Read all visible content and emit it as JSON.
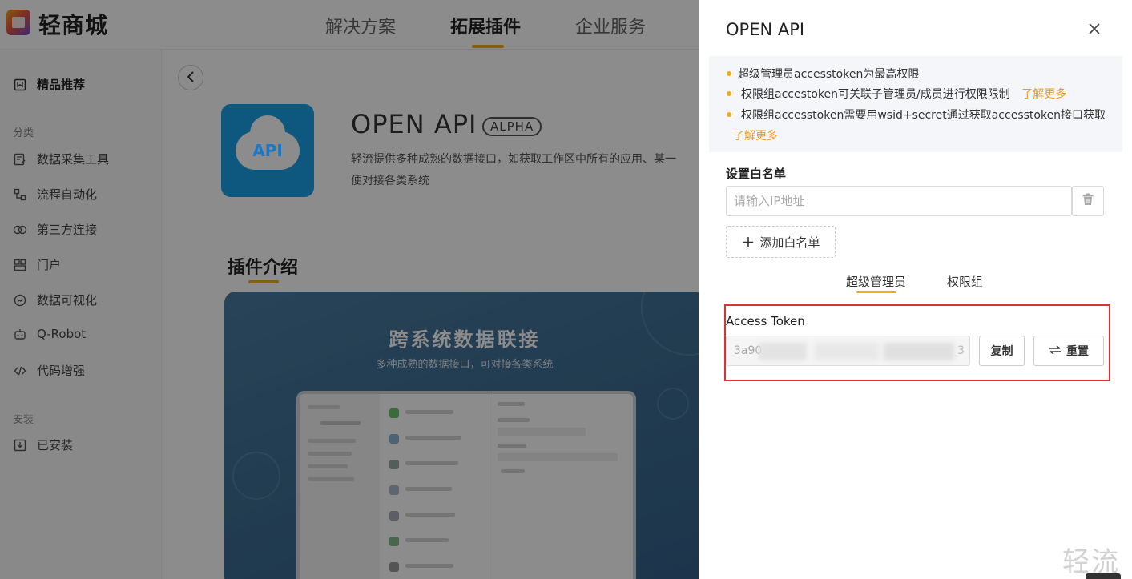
{
  "app": {
    "logo_text": "轻商城",
    "nav": [
      "解决方案",
      "拓展插件",
      "企业服务"
    ],
    "active_nav_index": 1
  },
  "sidebar": {
    "featured": "精品推荐",
    "category_label": "分类",
    "items": [
      "数据采集工具",
      "流程自动化",
      "第三方连接",
      "门户",
      "数据可视化",
      "Q-Robot",
      "代码增强"
    ],
    "installed_label": "安装",
    "installed_item": "已安装"
  },
  "product": {
    "logo_text": "API",
    "title": "OPEN API",
    "badge": "ALPHA",
    "description_line1": "轻流提供多种成熟的数据接口，如获取工作区中所有的应用、某一",
    "description_line2": "便对接各类系统"
  },
  "intro": {
    "section_title": "插件介绍",
    "banner_title": "跨系统数据联接",
    "banner_subtitle": "多种成熟的数据接口，可对接各类系统"
  },
  "drawer": {
    "title": "OPEN API",
    "notices": [
      {
        "text": "超级管理员accesstoken为最高权限",
        "link": ""
      },
      {
        "text": "权限组accestoken可关联子管理员/成员进行权限限制",
        "link": "了解更多"
      },
      {
        "text": "权限组accesstoken需要用wsid+secret通过获取accesstoken接口获取",
        "link": "了解更多"
      }
    ],
    "whitelist": {
      "label": "设置白名单",
      "placeholder": "请输入IP地址",
      "value": "",
      "add_label": "添加白名单"
    },
    "tabs": [
      "超级管理员",
      "权限组"
    ],
    "active_tab_index": 0,
    "token": {
      "label": "Access Token",
      "value_prefix": "3a90",
      "value_suffix": "3",
      "copy_label": "复制",
      "reset_label": "重置"
    }
  },
  "watermark": "轻流",
  "colors": {
    "accent": "#f0ad1b",
    "link": "#f09a1f",
    "highlight_border": "#e03030",
    "api_logo": "#1b9ee5"
  }
}
